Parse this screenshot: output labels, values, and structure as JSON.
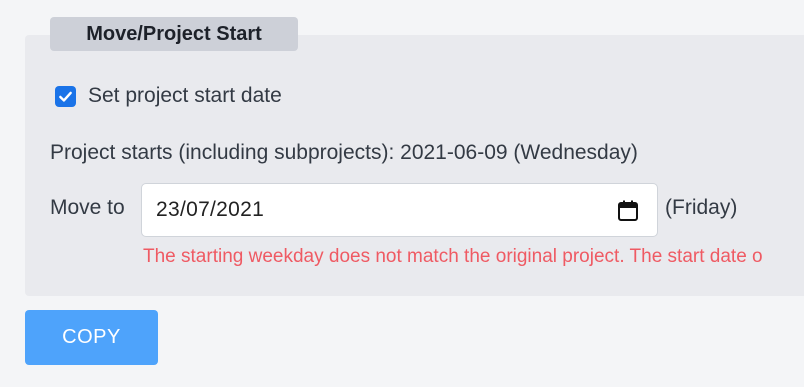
{
  "section": {
    "legend": "Move/Project Start"
  },
  "start_date_checkbox": {
    "label": "Set project start date",
    "checked": true
  },
  "project_starts_text": "Project starts (including subprojects): 2021-06-09 (Wednesday)",
  "move_to": {
    "label": "Move to",
    "value": "23/07/2021",
    "weekday": "(Friday)"
  },
  "warning_text": "The starting weekday does not match the original project. The start date o",
  "copy_button_label": "COPY",
  "icons": {
    "checkbox": "check-icon",
    "date_picker": "calendar-icon"
  },
  "colors": {
    "accent": "#1a73e8",
    "button": "#4ea3fb",
    "warning": "#ef5a63",
    "panel": "#e9eaee",
    "legend": "#cdd0d8"
  }
}
